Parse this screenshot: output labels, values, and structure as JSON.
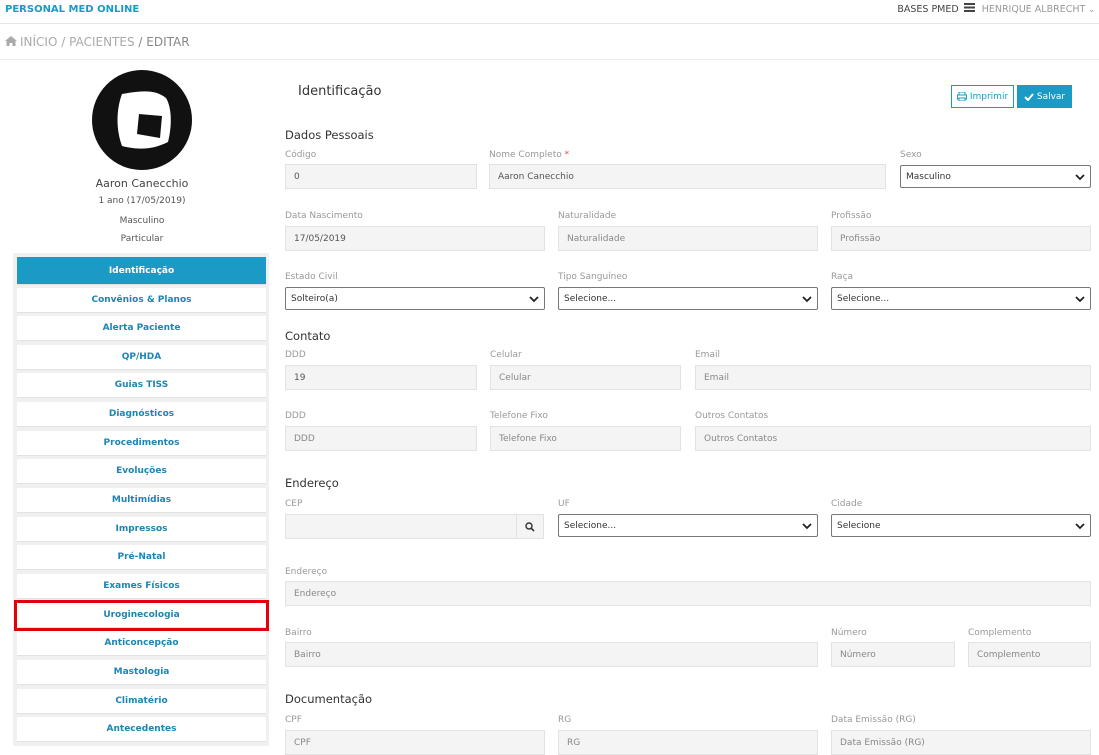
{
  "app": {
    "brand": "PERSONAL MED ONLINE",
    "bases": "BASES PMED",
    "user": "HENRIQUE ALBRECHT"
  },
  "breadcrumb": {
    "home": "INÍCIO",
    "patients": "/ PACIENTES",
    "current": "/ EDITAR"
  },
  "patient": {
    "name": "Aaron Canecchio",
    "age": "1 ano (17/05/2019)",
    "sex": "Masculino",
    "plan": "Particular"
  },
  "nav": {
    "items": [
      {
        "label": "Identificação",
        "active": true
      },
      {
        "label": "Convênios & Planos"
      },
      {
        "label": "Alerta Paciente"
      },
      {
        "label": "QP/HDA"
      },
      {
        "label": "Guias TISS"
      },
      {
        "label": "Diagnósticos"
      },
      {
        "label": "Procedimentos"
      },
      {
        "label": "Evoluções"
      },
      {
        "label": "Multimídias"
      },
      {
        "label": "Impressos"
      },
      {
        "label": "Pré-Natal"
      },
      {
        "label": "Exames Físicos"
      },
      {
        "label": "Uroginecologia",
        "highlighted": true
      },
      {
        "label": "Anticoncepção"
      },
      {
        "label": "Mastologia"
      },
      {
        "label": "Climatério"
      },
      {
        "label": "Antecedentes"
      }
    ]
  },
  "page": {
    "title": "Identificação",
    "print": "Imprimir",
    "save": "Salvar"
  },
  "sections": {
    "personal": "Dados Pessoais",
    "contact": "Contato",
    "address": "Endereço",
    "docs": "Documentação"
  },
  "fields": {
    "codigo": {
      "label": "Código",
      "value": "0"
    },
    "nome": {
      "label": "Nome Completo",
      "required": "*",
      "value": "Aaron Canecchio"
    },
    "sexo": {
      "label": "Sexo",
      "value": "Masculino"
    },
    "nascimento": {
      "label": "Data Nascimento",
      "value": "17/05/2019"
    },
    "naturalidade": {
      "label": "Naturalidade",
      "placeholder": "Naturalidade"
    },
    "profissao": {
      "label": "Profissão",
      "placeholder": "Profissão"
    },
    "estado_civil": {
      "label": "Estado Civil",
      "value": "Solteiro(a)"
    },
    "tipo_sanguineo": {
      "label": "Tipo Sanguíneo",
      "value": "Selecione..."
    },
    "raca": {
      "label": "Raça",
      "value": "Selecione..."
    },
    "ddd1": {
      "label": "DDD",
      "value": "19"
    },
    "celular": {
      "label": "Celular",
      "placeholder": "Celular"
    },
    "email": {
      "label": "Email",
      "placeholder": "Email"
    },
    "ddd2": {
      "label": "DDD",
      "placeholder": "DDD"
    },
    "telefone": {
      "label": "Telefone Fixo",
      "placeholder": "Telefone Fixo"
    },
    "outros": {
      "label": "Outros Contatos",
      "placeholder": "Outros Contatos"
    },
    "cep": {
      "label": "CEP"
    },
    "uf": {
      "label": "UF",
      "value": "Selecione..."
    },
    "cidade": {
      "label": "Cidade",
      "value": "Selecione"
    },
    "endereco": {
      "label": "Endereço",
      "placeholder": "Endereço"
    },
    "bairro": {
      "label": "Bairro",
      "placeholder": "Bairro"
    },
    "numero": {
      "label": "Número",
      "placeholder": "Número"
    },
    "complemento": {
      "label": "Complemento",
      "placeholder": "Complemento"
    },
    "cpf": {
      "label": "CPF",
      "placeholder": "CPF"
    },
    "rg": {
      "label": "RG",
      "placeholder": "RG"
    },
    "emissao": {
      "label": "Data Emissão (RG)",
      "placeholder": "Data Emissão (RG)"
    }
  },
  "colors": {
    "accent": "#1a9ac4",
    "highlight": "#e3000b"
  }
}
